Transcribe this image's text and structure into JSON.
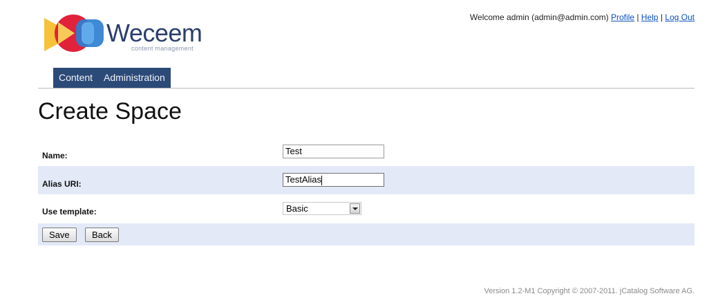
{
  "header": {
    "logo_name": "Weceem",
    "logo_tagline": "content management",
    "welcome_text": "Welcome admin (admin@admin.com)",
    "links": {
      "profile": "Profile",
      "help": "Help",
      "logout": "Log Out"
    },
    "separator": "|"
  },
  "nav": {
    "items": [
      {
        "label": "Content"
      },
      {
        "label": "Administration"
      }
    ]
  },
  "page": {
    "title": "Create Space"
  },
  "form": {
    "name": {
      "label": "Name:",
      "value": "Test"
    },
    "alias": {
      "label": "Alias URI:",
      "value": "TestAlias"
    },
    "template": {
      "label": "Use template:",
      "selected": "Basic"
    }
  },
  "actions": {
    "save_label": "Save",
    "back_label": "Back"
  },
  "footer": {
    "text": "Version 1.2-M1 Copyright © 2007-2011. jCatalog Software AG."
  },
  "colors": {
    "nav_background": "#2c4a78",
    "row_highlight": "#e3e9f7",
    "link": "#0b4fbf",
    "logo_text": "#2b3f6b"
  }
}
